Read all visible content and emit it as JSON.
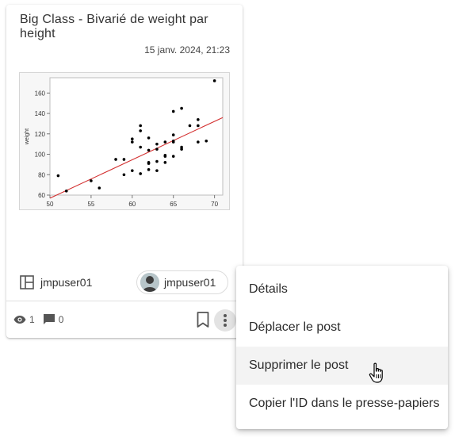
{
  "card": {
    "title": "Big Class - Bivarié de weight par height",
    "date": "15 janv. 2024, 21:23",
    "owner_label": "jmpuser01",
    "author_chip": "jmpuser01",
    "views": "1",
    "comments": "0"
  },
  "chart_data": {
    "type": "scatter",
    "title": "",
    "xlabel": "",
    "ylabel": "weight",
    "xlim": [
      50,
      71
    ],
    "ylim": [
      60,
      175
    ],
    "xticks": [
      50,
      55,
      60,
      65,
      70
    ],
    "yticks": [
      60,
      80,
      100,
      120,
      140,
      160
    ],
    "points": [
      [
        51,
        79
      ],
      [
        52,
        64
      ],
      [
        55,
        74
      ],
      [
        56,
        67
      ],
      [
        58,
        95
      ],
      [
        59,
        95
      ],
      [
        59,
        80
      ],
      [
        60,
        84
      ],
      [
        60,
        112
      ],
      [
        60,
        115
      ],
      [
        61,
        81
      ],
      [
        61,
        107
      ],
      [
        61,
        123
      ],
      [
        61,
        128
      ],
      [
        62,
        85
      ],
      [
        62,
        91
      ],
      [
        62,
        92
      ],
      [
        62,
        104
      ],
      [
        62,
        116
      ],
      [
        63,
        84
      ],
      [
        63,
        93
      ],
      [
        63,
        105
      ],
      [
        63,
        110
      ],
      [
        64,
        92
      ],
      [
        64,
        98
      ],
      [
        64,
        99
      ],
      [
        64,
        112
      ],
      [
        65,
        98
      ],
      [
        65,
        112
      ],
      [
        65,
        113
      ],
      [
        65,
        119
      ],
      [
        65,
        142
      ],
      [
        66,
        105
      ],
      [
        66,
        107
      ],
      [
        66,
        145
      ],
      [
        67,
        128
      ],
      [
        68,
        112
      ],
      [
        68,
        128
      ],
      [
        68,
        134
      ],
      [
        69,
        113
      ],
      [
        70,
        172
      ]
    ],
    "fit_line": {
      "color": "#d32f2f",
      "y_at_50": 57,
      "y_at_71": 136
    },
    "point_color": "#000000"
  },
  "menu": {
    "items": [
      {
        "label": "Détails"
      },
      {
        "label": "Déplacer le post"
      },
      {
        "label": "Supprimer le post"
      },
      {
        "label": "Copier l'ID dans le presse-papiers"
      }
    ]
  },
  "icons": {
    "owner": "layout-panel-icon",
    "views": "eye-icon",
    "comments": "comment-icon",
    "bookmark": "bookmark-icon",
    "more": "more-vertical-icon",
    "cursor": "hand-pointer-icon"
  }
}
